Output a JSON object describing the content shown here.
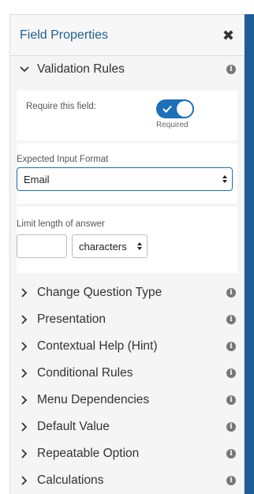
{
  "header": {
    "title": "Field Properties",
    "close_symbol": "✖"
  },
  "validation": {
    "label": "Validation Rules",
    "require_label": "Require this field:",
    "required_toggle": {
      "state": "on",
      "caption": "Required"
    },
    "format_label": "Expected Input Format",
    "format_value": "Email",
    "limit_label": "Limit length of answer",
    "limit_value": "",
    "limit_unit": "characters"
  },
  "sections": [
    {
      "label": "Change Question Type"
    },
    {
      "label": "Presentation"
    },
    {
      "label": "Contextual Help (Hint)"
    },
    {
      "label": "Conditional Rules"
    },
    {
      "label": "Menu Dependencies"
    },
    {
      "label": "Default Value"
    },
    {
      "label": "Repeatable Option"
    },
    {
      "label": "Calculations"
    }
  ],
  "colors": {
    "accent": "#1d5f95",
    "toggle_on": "#1d6fb8",
    "panel_bg": "#f5f5f5"
  }
}
